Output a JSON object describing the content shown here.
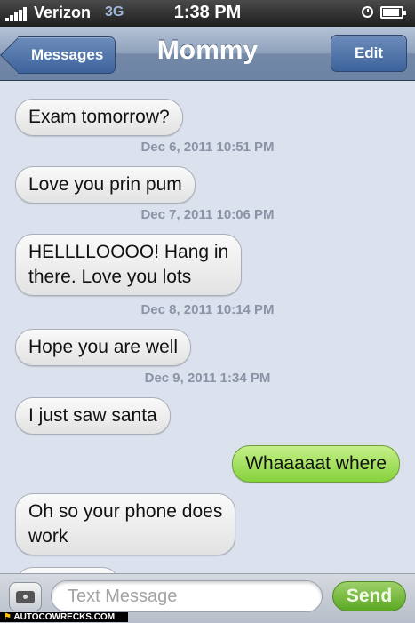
{
  "status_bar": {
    "carrier": "Verizon",
    "network": "3G",
    "time": "1:38 PM"
  },
  "nav": {
    "back_label": "Messages",
    "title": "Mommy",
    "edit_label": "Edit"
  },
  "messages": [
    {
      "type": "in",
      "text": "Exam tomorrow?"
    },
    {
      "type": "timestamp",
      "text": "Dec 6, 2011 10:51 PM"
    },
    {
      "type": "in",
      "text": "Love you prin pum"
    },
    {
      "type": "timestamp",
      "text": "Dec 7, 2011 10:06 PM"
    },
    {
      "type": "in",
      "text": "HELLLLOOOO! Hang in\nthere. Love you lots"
    },
    {
      "type": "timestamp",
      "text": "Dec 8, 2011 10:14 PM"
    },
    {
      "type": "in",
      "text": "Hope you are well"
    },
    {
      "type": "timestamp",
      "text": "Dec 9, 2011 1:34 PM"
    },
    {
      "type": "in",
      "text": "I just saw santa"
    },
    {
      "type": "out",
      "text": "Whaaaaat where"
    },
    {
      "type": "in",
      "text": "Oh so your phone does\nwork"
    }
  ],
  "input": {
    "placeholder": "Text Message",
    "send_label": "Send"
  },
  "watermark": {
    "text": "AUTOCOWRECKS.COM"
  }
}
